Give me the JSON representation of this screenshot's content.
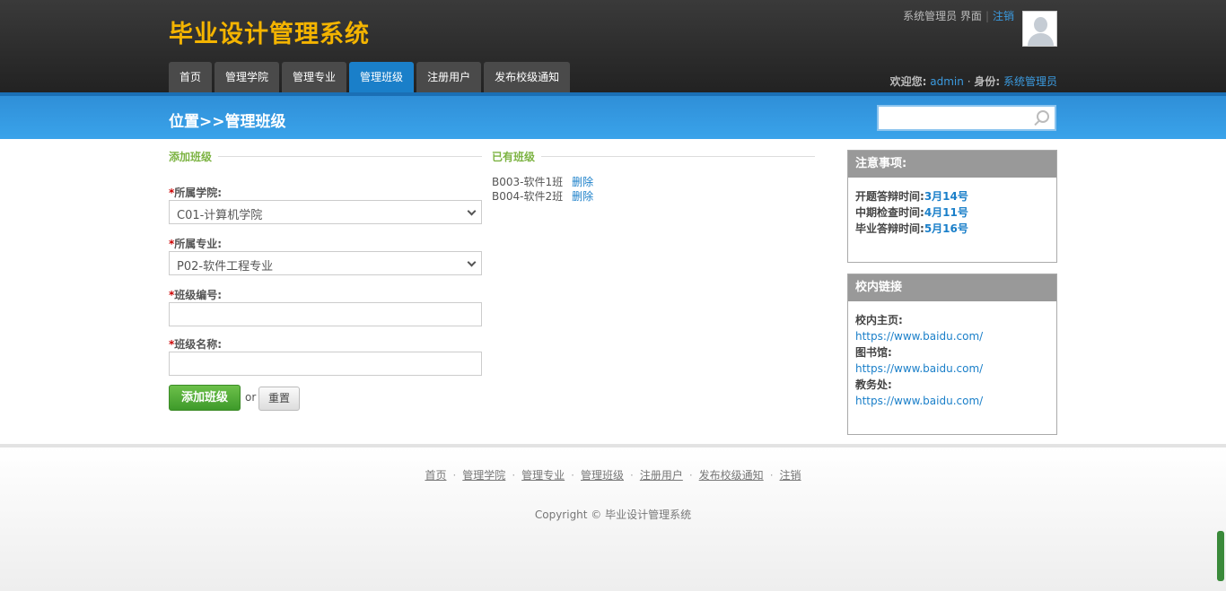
{
  "header": {
    "site_title": "毕业设计管理系统",
    "top_links": {
      "role": "系统管理员",
      "interface": "界面",
      "logout": "注销"
    },
    "nav": [
      "首页",
      "管理学院",
      "管理专业",
      "管理班级",
      "注册用户",
      "发布校级通知"
    ],
    "nav_active_index": 3,
    "welcome": {
      "label": "欢迎您:",
      "user": "admin",
      "sep": "·",
      "role_label": "身份:",
      "role": "系统管理员"
    }
  },
  "bluebar": {
    "breadcrumb": "位置>>管理班级",
    "search_placeholder": ""
  },
  "add_section": {
    "title": "添加班级",
    "college_label": "所属学院:",
    "college_value": "C01-计算机学院",
    "major_label": "所属专业:",
    "major_value": "P02-软件工程专业",
    "class_no_label": "班级编号:",
    "class_no_value": "",
    "class_name_label": "班级名称:",
    "class_name_value": "",
    "required_mark": "*",
    "add_button": "添加班级",
    "or_text": "or",
    "reset_button": "重置"
  },
  "existing_section": {
    "title": "已有班级",
    "items": [
      {
        "name": "B003-软件1班",
        "action": "删除"
      },
      {
        "name": "B004-软件2班",
        "action": "删除"
      }
    ]
  },
  "notice_box": {
    "title": "注意事项:",
    "items": [
      {
        "label": "开题答辩时间:",
        "value": "3月14号"
      },
      {
        "label": "中期检查时间:",
        "value": "4月11号"
      },
      {
        "label": "毕业答辩时间:",
        "value": "5月16号"
      }
    ]
  },
  "links_box": {
    "title": "校内链接",
    "items": [
      {
        "label": "校内主页:",
        "url": "https://www.baidu.com/"
      },
      {
        "label": "图书馆:",
        "url": "https://www.baidu.com/"
      },
      {
        "label": "教务处:",
        "url": "https://www.baidu.com/"
      }
    ]
  },
  "footer": {
    "links": [
      "首页",
      "管理学院",
      "管理专业",
      "管理班级",
      "注册用户",
      "发布校级通知",
      "注销"
    ],
    "copyright": "Copyright © 毕业设计管理系统"
  },
  "colors": {
    "accent": "#1a7fc9",
    "title": "#f4b400",
    "section_title": "#7cb342"
  }
}
